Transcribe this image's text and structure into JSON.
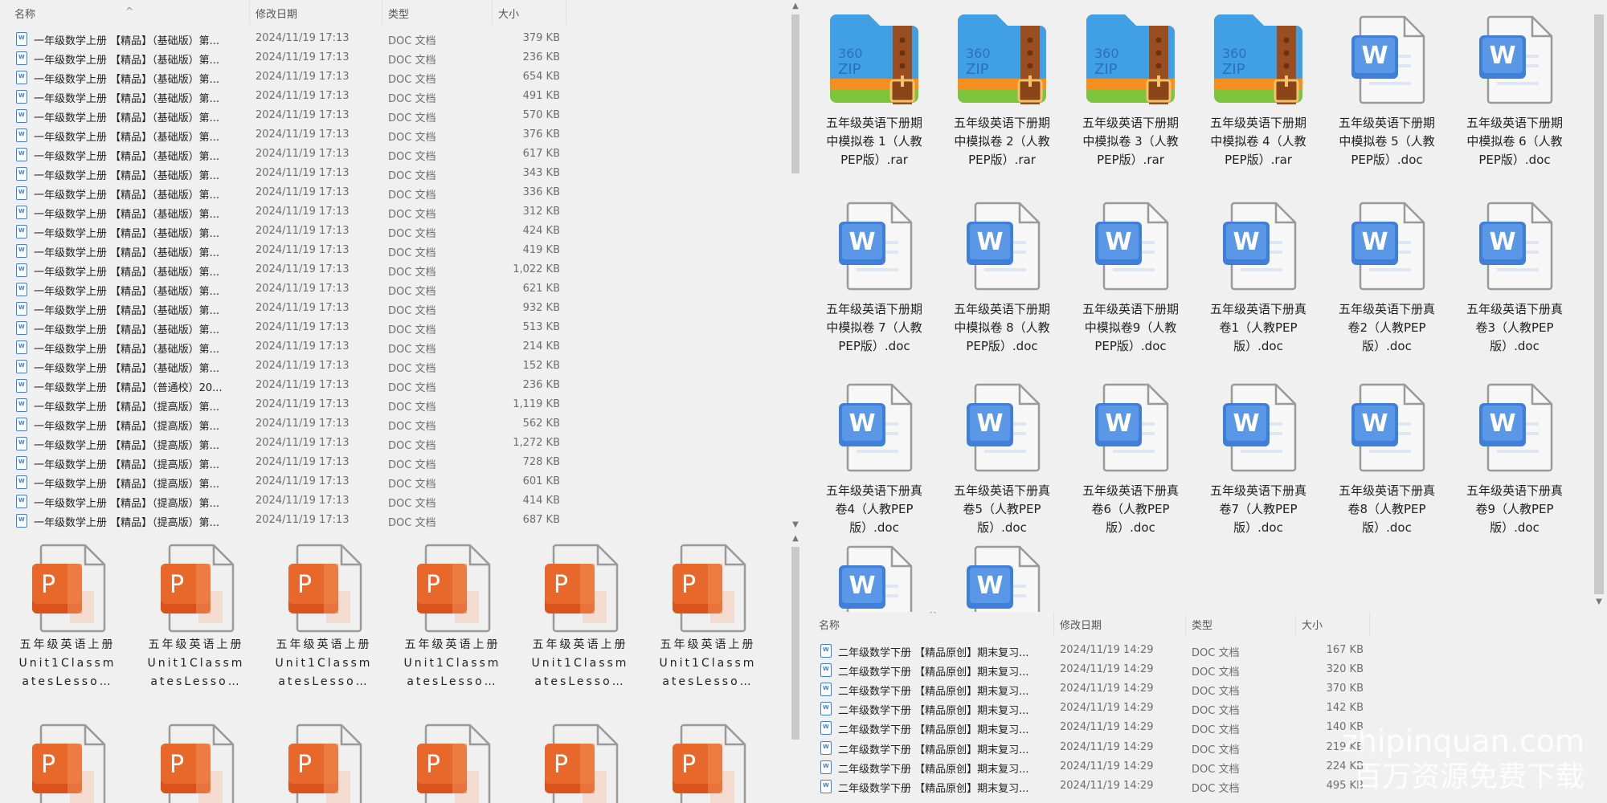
{
  "left_list": {
    "headers": {
      "name": "名称",
      "date": "修改日期",
      "type": "类型",
      "size": "大小"
    },
    "rows": [
      {
        "name": "一年级数学上册 【精品】（基础版）第...",
        "date": "2024/11/19 17:13",
        "type": "DOC 文档",
        "size": "379 KB"
      },
      {
        "name": "一年级数学上册 【精品】（基础版）第...",
        "date": "2024/11/19 17:13",
        "type": "DOC 文档",
        "size": "236 KB"
      },
      {
        "name": "一年级数学上册 【精品】（基础版）第...",
        "date": "2024/11/19 17:13",
        "type": "DOC 文档",
        "size": "654 KB"
      },
      {
        "name": "一年级数学上册 【精品】（基础版）第...",
        "date": "2024/11/19 17:13",
        "type": "DOC 文档",
        "size": "491 KB"
      },
      {
        "name": "一年级数学上册 【精品】（基础版）第...",
        "date": "2024/11/19 17:13",
        "type": "DOC 文档",
        "size": "570 KB"
      },
      {
        "name": "一年级数学上册 【精品】（基础版）第...",
        "date": "2024/11/19 17:13",
        "type": "DOC 文档",
        "size": "376 KB"
      },
      {
        "name": "一年级数学上册 【精品】（基础版）第...",
        "date": "2024/11/19 17:13",
        "type": "DOC 文档",
        "size": "617 KB"
      },
      {
        "name": "一年级数学上册 【精品】（基础版）第...",
        "date": "2024/11/19 17:13",
        "type": "DOC 文档",
        "size": "343 KB"
      },
      {
        "name": "一年级数学上册 【精品】（基础版）第...",
        "date": "2024/11/19 17:13",
        "type": "DOC 文档",
        "size": "336 KB"
      },
      {
        "name": "一年级数学上册 【精品】（基础版）第...",
        "date": "2024/11/19 17:13",
        "type": "DOC 文档",
        "size": "312 KB"
      },
      {
        "name": "一年级数学上册 【精品】（基础版）第...",
        "date": "2024/11/19 17:13",
        "type": "DOC 文档",
        "size": "424 KB"
      },
      {
        "name": "一年级数学上册 【精品】（基础版）第...",
        "date": "2024/11/19 17:13",
        "type": "DOC 文档",
        "size": "419 KB"
      },
      {
        "name": "一年级数学上册 【精品】（基础版）第...",
        "date": "2024/11/19 17:13",
        "type": "DOC 文档",
        "size": "1,022 KB"
      },
      {
        "name": "一年级数学上册 【精品】（基础版）第...",
        "date": "2024/11/19 17:13",
        "type": "DOC 文档",
        "size": "621 KB"
      },
      {
        "name": "一年级数学上册 【精品】（基础版）第...",
        "date": "2024/11/19 17:13",
        "type": "DOC 文档",
        "size": "932 KB"
      },
      {
        "name": "一年级数学上册 【精品】（基础版）第...",
        "date": "2024/11/19 17:13",
        "type": "DOC 文档",
        "size": "513 KB"
      },
      {
        "name": "一年级数学上册 【精品】（基础版）第...",
        "date": "2024/11/19 17:13",
        "type": "DOC 文档",
        "size": "214 KB"
      },
      {
        "name": "一年级数学上册 【精品】（基础版）第...",
        "date": "2024/11/19 17:13",
        "type": "DOC 文档",
        "size": "152 KB"
      },
      {
        "name": "一年级数学上册 【精品】（普通校）20...",
        "date": "2024/11/19 17:13",
        "type": "DOC 文档",
        "size": "236 KB"
      },
      {
        "name": "一年级数学上册 【精品】（提高版）第...",
        "date": "2024/11/19 17:13",
        "type": "DOC 文档",
        "size": "1,119 KB"
      },
      {
        "name": "一年级数学上册 【精品】（提高版）第...",
        "date": "2024/11/19 17:13",
        "type": "DOC 文档",
        "size": "562 KB"
      },
      {
        "name": "一年级数学上册 【精品】（提高版）第...",
        "date": "2024/11/19 17:13",
        "type": "DOC 文档",
        "size": "1,272 KB"
      },
      {
        "name": "一年级数学上册 【精品】（提高版）第...",
        "date": "2024/11/19 17:13",
        "type": "DOC 文档",
        "size": "728 KB"
      },
      {
        "name": "一年级数学上册 【精品】（提高版）第...",
        "date": "2024/11/19 17:13",
        "type": "DOC 文档",
        "size": "601 KB"
      },
      {
        "name": "一年级数学上册 【精品】（提高版）第...",
        "date": "2024/11/19 17:13",
        "type": "DOC 文档",
        "size": "414 KB"
      },
      {
        "name": "一年级数学上册 【精品】（提高版）第...",
        "date": "2024/11/19 17:13",
        "type": "DOC 文档",
        "size": "687 KB"
      }
    ]
  },
  "ppt_grid": {
    "items": [
      {
        "name": "五年级英语上册Unit1ClassmatesLesso…",
        "icon": "ppt"
      },
      {
        "name": "五年级英语上册Unit1ClassmatesLesso…",
        "icon": "ppt"
      },
      {
        "name": "五年级英语上册Unit1ClassmatesLesso…",
        "icon": "ppt"
      },
      {
        "name": "五年级英语上册Unit1ClassmatesLesso…",
        "icon": "ppt"
      },
      {
        "name": "五年级英语上册Unit1ClassmatesLesso…",
        "icon": "ppt"
      },
      {
        "name": "五年级英语上册Unit1ClassmatesLesso…",
        "icon": "ppt"
      },
      {
        "name": "",
        "icon": "ppt"
      },
      {
        "name": "",
        "icon": "ppt"
      },
      {
        "name": "",
        "icon": "ppt"
      },
      {
        "name": "",
        "icon": "ppt"
      },
      {
        "name": "",
        "icon": "ppt"
      },
      {
        "name": "",
        "icon": "ppt"
      }
    ]
  },
  "right_grid": {
    "items": [
      {
        "name": "五年级英语下册期中模拟卷 1（人教PEP版）.rar",
        "icon": "zip"
      },
      {
        "name": "五年级英语下册期中模拟卷 2（人教PEP版）.rar",
        "icon": "zip"
      },
      {
        "name": "五年级英语下册期中模拟卷 3（人教PEP版）.rar",
        "icon": "zip"
      },
      {
        "name": "五年级英语下册期中模拟卷 4（人教PEP版）.rar",
        "icon": "zip"
      },
      {
        "name": "五年级英语下册期中模拟卷 5（人教PEP版）.doc",
        "icon": "word"
      },
      {
        "name": "五年级英语下册期中模拟卷 6（人教PEP版）.doc",
        "icon": "word"
      },
      {
        "name": "五年级英语下册期中模拟卷 7（人教PEP版）.doc",
        "icon": "word"
      },
      {
        "name": "五年级英语下册期中模拟卷 8（人教PEP版）.doc",
        "icon": "word"
      },
      {
        "name": "五年级英语下册期中模拟卷9（人教PEP版）.doc",
        "icon": "word"
      },
      {
        "name": "五年级英语下册真卷1（人教PEP版）.doc",
        "icon": "word"
      },
      {
        "name": "五年级英语下册真卷2（人教PEP版）.doc",
        "icon": "word"
      },
      {
        "name": "五年级英语下册真卷3（人教PEP版）.doc",
        "icon": "word"
      },
      {
        "name": "五年级英语下册真卷4（人教PEP版）.doc",
        "icon": "word"
      },
      {
        "name": "五年级英语下册真卷5（人教PEP版）.doc",
        "icon": "word"
      },
      {
        "name": "五年级英语下册真卷6（人教PEP版）.doc",
        "icon": "word"
      },
      {
        "name": "五年级英语下册真卷7（人教PEP版）.doc",
        "icon": "word"
      },
      {
        "name": "五年级英语下册真卷8（人教PEP版）.doc",
        "icon": "word"
      },
      {
        "name": "五年级英语下册真卷9（人教PEP版）.doc",
        "icon": "word"
      },
      {
        "name": "",
        "icon": "word"
      },
      {
        "name": "",
        "icon": "word"
      }
    ]
  },
  "right_list": {
    "headers": {
      "name": "名称",
      "date": "修改日期",
      "type": "类型",
      "size": "大小"
    },
    "rows": [
      {
        "name": "二年级数学下册 【精品原创】期末复习...",
        "date": "2024/11/19 14:29",
        "type": "DOC 文档",
        "size": "167 KB"
      },
      {
        "name": "二年级数学下册 【精品原创】期末复习...",
        "date": "2024/11/19 14:29",
        "type": "DOC 文档",
        "size": "320 KB"
      },
      {
        "name": "二年级数学下册 【精品原创】期末复习...",
        "date": "2024/11/19 14:29",
        "type": "DOC 文档",
        "size": "370 KB"
      },
      {
        "name": "二年级数学下册 【精品原创】期末复习...",
        "date": "2024/11/19 14:29",
        "type": "DOC 文档",
        "size": "142 KB"
      },
      {
        "name": "二年级数学下册 【精品原创】期末复习...",
        "date": "2024/11/19 14:29",
        "type": "DOC 文档",
        "size": "140 KB"
      },
      {
        "name": "二年级数学下册 【精品原创】期末复习...",
        "date": "2024/11/19 14:29",
        "type": "DOC 文档",
        "size": "219 KB"
      },
      {
        "name": "二年级数学下册 【精品原创】期末复习...",
        "date": "2024/11/19 14:29",
        "type": "DOC 文档",
        "size": "224 KB"
      },
      {
        "name": "二年级数学下册 【精品原创】期末复习...",
        "date": "2024/11/19 14:29",
        "type": "DOC 文档",
        "size": "495 KB"
      }
    ]
  },
  "watermark": {
    "line1": "zhipinquan.com",
    "line2": "百万资源免费下载"
  },
  "colors": {
    "word_blue": "#3f7fd8",
    "ppt_orange": "#e8672a",
    "zip_blue": "#3fa0e6",
    "zip_orange": "#f39020",
    "zip_green": "#7cc43c",
    "strap_brown": "#9a4d1e"
  }
}
